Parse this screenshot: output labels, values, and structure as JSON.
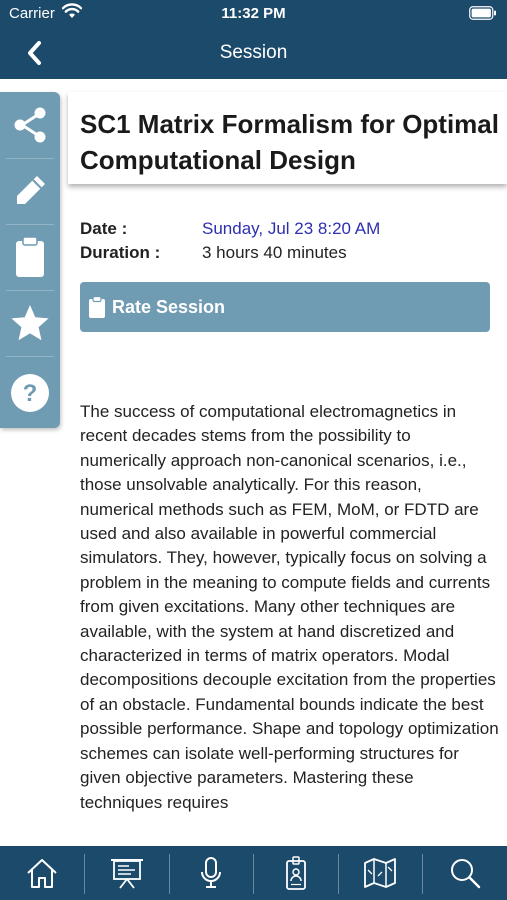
{
  "status_bar": {
    "carrier": "Carrier",
    "time": "11:32 PM"
  },
  "nav": {
    "title": "Session",
    "back_icon": "chevron-left-icon"
  },
  "sidebar": {
    "items": [
      {
        "name": "share",
        "icon": "share-icon"
      },
      {
        "name": "edit-note",
        "icon": "pencil-icon"
      },
      {
        "name": "clipboard",
        "icon": "clipboard-icon"
      },
      {
        "name": "favorite",
        "icon": "star-icon"
      },
      {
        "name": "help",
        "icon": "question-icon"
      }
    ]
  },
  "session": {
    "title": "SC1 Matrix Formalism for Optimal Computational Design",
    "date_label": "Date :",
    "date_value": "Sunday, Jul 23 8:20 AM",
    "duration_label": "Duration :",
    "duration_value": "3 hours 40 minutes",
    "rate_label": "Rate Session",
    "description": "The success of computational electromagnetics in recent decades stems from the possibility to numerically approach non-canonical scenarios, i.e., those unsolvable analytically. For this reason, numerical methods such as FEM, MoM, or FDTD are used and also available in powerful commercial simulators. They, however, typically focus on solving a problem in the meaning to compute fields and currents from given excitations. Many other techniques are available, with the system at hand discretized and characterized in terms of matrix operators. Modal decompositions decouple excitation from the properties of an obstacle. Fundamental bounds indicate the best possible performance. Shape and topology optimization schemes can isolate well-performing structures for given objective parameters. Mastering these techniques requires"
  },
  "tabbar": {
    "items": [
      {
        "name": "home",
        "icon": "home-icon"
      },
      {
        "name": "presentation",
        "icon": "presentation-icon"
      },
      {
        "name": "microphone",
        "icon": "microphone-icon"
      },
      {
        "name": "badge",
        "icon": "id-badge-icon"
      },
      {
        "name": "map",
        "icon": "map-icon"
      },
      {
        "name": "search",
        "icon": "search-icon"
      }
    ]
  },
  "colors": {
    "header": "#1c4a6b",
    "sidebar": "#6f9bb3",
    "accent_date": "#2d2fb0",
    "rate_button": "#6f9bb3"
  }
}
